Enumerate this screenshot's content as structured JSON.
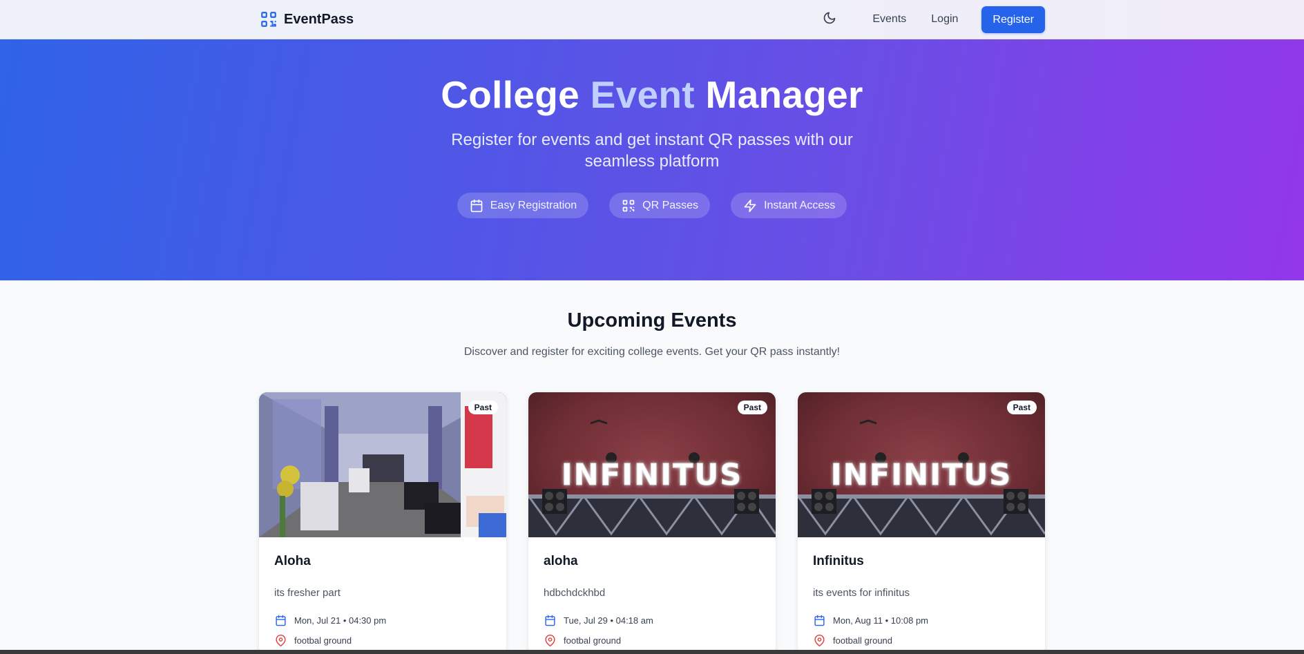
{
  "navbar": {
    "brand": "EventPass",
    "links": {
      "events": "Events",
      "login": "Login",
      "register": "Register"
    }
  },
  "hero": {
    "title_part1": "College",
    "title_accent": "Event",
    "title_part2": "Manager",
    "subtitle": "Register for events and get instant QR passes with our seamless platform",
    "features": [
      "Easy Registration",
      "QR Passes",
      "Instant Access"
    ]
  },
  "section": {
    "title": "Upcoming Events",
    "subtitle": "Discover and register for exciting college events. Get your QR pass instantly!"
  },
  "events": [
    {
      "badge": "Past",
      "title": "Aloha",
      "description": "its fresher part",
      "date": "Mon, Jul 21 • 04:30 pm",
      "location": "footbal ground"
    },
    {
      "badge": "Past",
      "title": "aloha",
      "description": "hdbchdckhbd",
      "date": "Tue, Jul 29 • 04:18 am",
      "location": "footbal ground",
      "image_text": "INFINITUS"
    },
    {
      "badge": "Past",
      "title": "Infinitus",
      "description": "its events for infinitus",
      "date": "Mon, Aug 11 • 10:08 pm",
      "location": "football ground",
      "image_text": "INFINITUS"
    }
  ],
  "colors": {
    "primary": "#2563eb",
    "hero_start": "#2f63e8",
    "hero_end": "#9337e9",
    "accent_text": "#bfd0ff",
    "pin": "#e23b3b"
  },
  "icons": {
    "brand": "qr-code-icon",
    "theme": "moon-icon",
    "features": [
      "calendar-icon",
      "qr-code-icon",
      "lightning-icon"
    ],
    "meta": [
      "calendar-icon",
      "map-pin-icon"
    ]
  }
}
